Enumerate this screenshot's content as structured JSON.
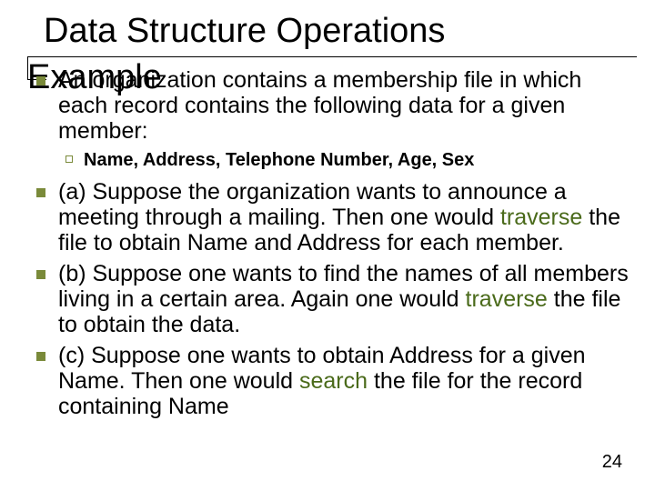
{
  "title": "Data Structure Operations",
  "subtitle_overlay": "Example",
  "bullets": {
    "intro": "An organization contains a membership file in which each record contains the following data for a given member:",
    "sub1": "Name, Address, Telephone Number, Age, Sex",
    "a_pre": "(a) Suppose the organization wants to announce a meeting through a mailing. Then one would ",
    "a_kw": "traverse",
    "a_post": " the file to obtain Name and Address for each member.",
    "b_pre": "(b) Suppose one wants to find the names of all members living in a certain area. Again one would ",
    "b_kw": "traverse",
    "b_post": " the file to obtain the data.",
    "c_pre": "(c) Suppose one wants to obtain Address for a given Name. Then one would ",
    "c_kw": "search",
    "c_post": " the file for the record containing Name"
  },
  "page_number": "24"
}
